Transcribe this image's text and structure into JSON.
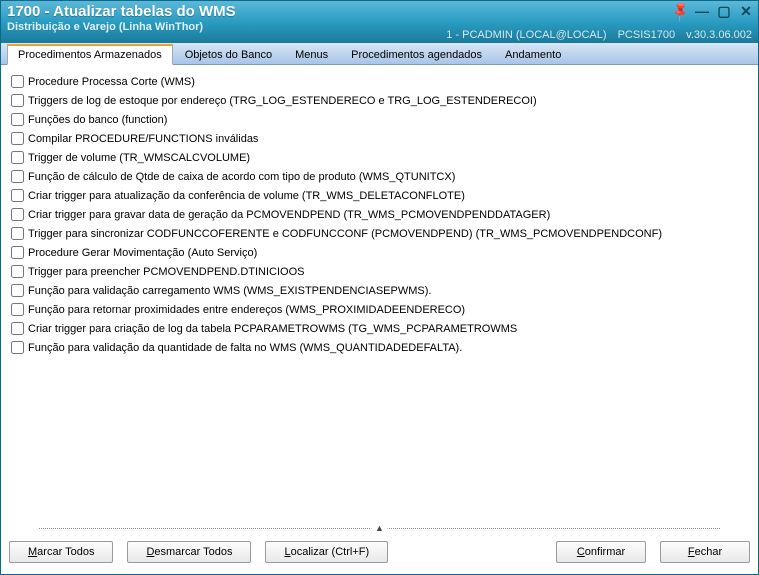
{
  "window": {
    "title": "1700 - Atualizar tabelas do WMS",
    "subtitle": "Distribuição e Varejo (Linha WinThor)",
    "userinfo": "1 - PCADMIN (LOCAL@LOCAL)",
    "module": "PCSIS1700",
    "version": "v.30.3.06.002"
  },
  "tabs": [
    {
      "label": "Procedimentos Armazenados",
      "active": true
    },
    {
      "label": "Objetos do Banco",
      "active": false
    },
    {
      "label": "Menus",
      "active": false
    },
    {
      "label": "Procedimentos agendados",
      "active": false
    },
    {
      "label": "Andamento",
      "active": false
    }
  ],
  "items": [
    "Procedure Processa Corte (WMS)",
    "Triggers de log de estoque por endereço (TRG_LOG_ESTENDERECO e TRG_LOG_ESTENDERECOI)",
    "Funções do banco (function)",
    "Compilar PROCEDURE/FUNCTIONS inválidas",
    "Trigger de volume (TR_WMSCALCVOLUME)",
    "Função de cálculo de Qtde de caixa de acordo com tipo de produto (WMS_QTUNITCX)",
    "Criar trigger para atualização da conferência de volume (TR_WMS_DELETACONFLOTE)",
    "Criar trigger para gravar data de geração da PCMOVENDPEND (TR_WMS_PCMOVENDPENDDATAGER)",
    "Trigger para sincronizar CODFUNCCOFERENTE e CODFUNCCONF (PCMOVENDPEND) (TR_WMS_PCMOVENDPENDCONF)",
    "Procedure Gerar Movimentação (Auto Serviço)",
    "Trigger para preencher PCMOVENDPEND.DTINICIOOS",
    "Função para validação carregamento WMS (WMS_EXISTPENDENCIASEPWMS).",
    "Função para retornar proximidades entre endereços (WMS_PROXIMIDADEENDERECO)",
    "Criar trigger para criação de log da tabela PCPARAMETROWMS (TG_WMS_PCPARAMETROWMS",
    "Função para validação da quantidade de falta no WMS (WMS_QUANTIDADEDEFALTA)."
  ],
  "buttons": {
    "mark_all": "Marcar Todos",
    "unmark_all": "Desmarcar Todos",
    "find": "Localizar (Ctrl+F)",
    "confirm": "Confirmar",
    "close": "Fechar"
  }
}
